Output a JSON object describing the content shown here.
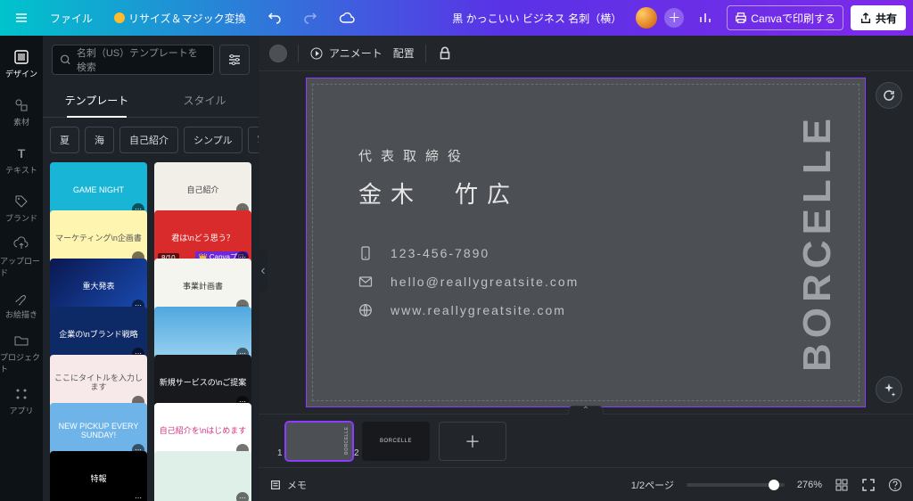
{
  "topbar": {
    "file": "ファイル",
    "resize": "リサイズ＆マジック変換",
    "doc_title": "黒 かっこいい ビジネス 名刺（横）",
    "print": "Canvaで印刷する",
    "share": "共有"
  },
  "rail": [
    {
      "label": "デザイン"
    },
    {
      "label": "素材"
    },
    {
      "label": "テキスト"
    },
    {
      "label": "ブランド"
    },
    {
      "label": "アップロード"
    },
    {
      "label": "お絵描き"
    },
    {
      "label": "プロジェクト"
    },
    {
      "label": "アプリ"
    }
  ],
  "panel": {
    "search_placeholder": "名刺（US）テンプレートを検索",
    "tab_templates": "テンプレート",
    "tab_styles": "スタイル",
    "chips": [
      "夏",
      "海",
      "自己紹介",
      "シンプル",
      "写"
    ],
    "templates": [
      {
        "label": "GAME NIGHT",
        "bg": "#19b5d6"
      },
      {
        "label": "自己紹介",
        "bg": "#f2efe9",
        "fg": "#444"
      },
      {
        "label": "マーケティング\\n企画書",
        "bg": "#fef5b0",
        "fg": "#555"
      },
      {
        "label": "君は\\nどう思う？",
        "bg": "#d92b2b",
        "pro": "8/10",
        "canvapro": "Canvaプロ"
      },
      {
        "label": "重大発表",
        "bg": "linear-gradient(135deg,#0a1850,#1a4db5)"
      },
      {
        "label": "事業計画書",
        "bg": "#f5f5f0",
        "fg": "#333"
      },
      {
        "label": "企業の\\nブランド戦略",
        "bg": "#0e2a66"
      },
      {
        "label": "",
        "bg": "linear-gradient(180deg,#4fa8e0,#9fd4f0)"
      },
      {
        "label": "ここにタイトルを入力します",
        "bg": "#f7e9e9",
        "fg": "#555"
      },
      {
        "label": "新規サービスの\\nご提案",
        "bg": "#17191c"
      },
      {
        "label": "NEW PICKUP EVERY SUNDAY!",
        "bg": "#6fb4e8"
      },
      {
        "label": "自己紹介を\\nはじめます",
        "bg": "#fff",
        "fg": "#d63384"
      },
      {
        "label": "特報",
        "bg": "#000"
      },
      {
        "label": "",
        "bg": "#dff0e8"
      }
    ]
  },
  "context": {
    "animate": "アニメート",
    "position": "配置"
  },
  "card": {
    "role": "代表取締役",
    "name": "金木　竹広",
    "phone": "123-456-7890",
    "email": "hello@reallygreatsite.com",
    "web": "www.reallygreatsite.com",
    "brand": "BORCELLE"
  },
  "footer": {
    "notes": "メモ",
    "page_indicator": "1/2ページ",
    "zoom": "276%"
  }
}
